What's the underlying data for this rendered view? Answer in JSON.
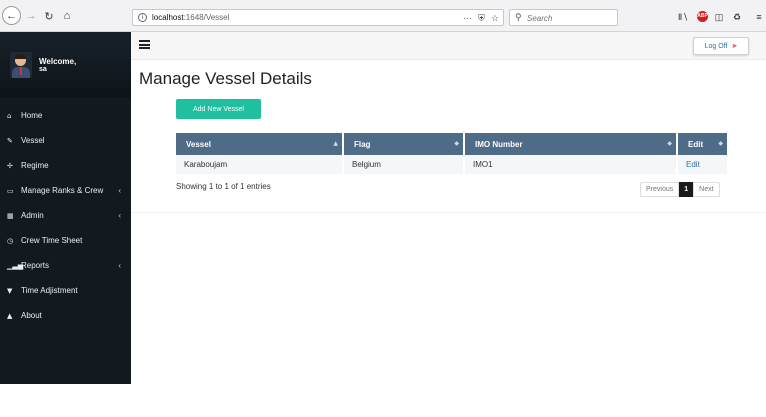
{
  "browser": {
    "url_host": "localhost",
    "url_path": ":1648/Vessel",
    "search_placeholder": "Search",
    "more_label": "···",
    "abp_label": "ABP"
  },
  "sidebar": {
    "welcome": "Welcome,",
    "username": "sa",
    "items": [
      {
        "label": "Home",
        "icon": "⌂",
        "chevron": ""
      },
      {
        "label": "Vessel",
        "icon": "✎",
        "chevron": ""
      },
      {
        "label": "Regime",
        "icon": "✢",
        "chevron": ""
      },
      {
        "label": "Manage Ranks & Crew",
        "icon": "▭",
        "chevron": "‹"
      },
      {
        "label": "Admin",
        "icon": "▦",
        "chevron": "‹"
      },
      {
        "label": "Crew Time Sheet",
        "icon": "◷",
        "chevron": ""
      },
      {
        "label": "Reports",
        "icon": "▁▃▅",
        "chevron": "‹"
      },
      {
        "label": "Time Adjistment",
        "icon": "▼",
        "chevron": ""
      },
      {
        "label": "About",
        "icon": "▲",
        "chevron": ""
      }
    ]
  },
  "header": {
    "logoff_label": "Log Off"
  },
  "main": {
    "title": "Manage Vessel Details",
    "add_button": "Add New Vessel",
    "table": {
      "headers": [
        "Vessel",
        "Flag",
        "IMO Number",
        "Edit"
      ],
      "rows": [
        {
          "vessel": "Karaboujam",
          "flag": "Belgium",
          "imo": "IMO1",
          "edit": "Edit"
        }
      ]
    },
    "info": "Showing 1 to 1 of 1 entries",
    "pagination": {
      "previous": "Previous",
      "current": "1",
      "next": "Next"
    }
  },
  "colors": {
    "sidebar_bg": "#121a20",
    "table_header_bg": "#4e6b87",
    "add_button_bg": "#1fbf9f",
    "link": "#2f6fb0",
    "active_page_bg": "#1a1a1a"
  }
}
